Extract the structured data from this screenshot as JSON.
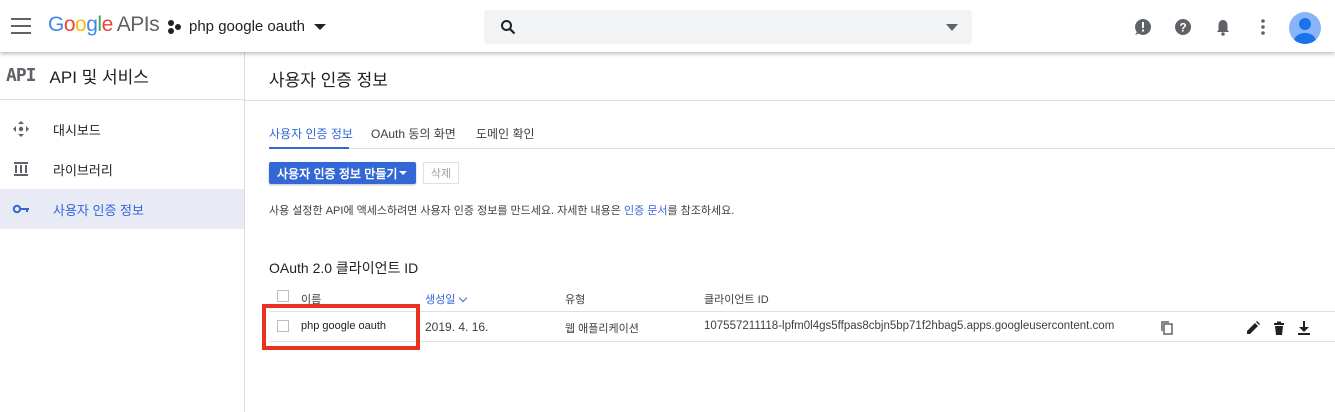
{
  "header": {
    "logo_text": "Google",
    "logo_suffix": "APIs",
    "project_name": "php google oauth",
    "search": {
      "placeholder": ""
    }
  },
  "sidebar": {
    "badge": "API",
    "title": "API 및 서비스",
    "items": [
      {
        "label": "대시보드",
        "icon": "dashboard-icon"
      },
      {
        "label": "라이브러리",
        "icon": "library-icon"
      },
      {
        "label": "사용자 인증 정보",
        "icon": "key-icon",
        "active": true
      }
    ]
  },
  "main": {
    "page_title": "사용자 인증 정보",
    "tabs": [
      {
        "label": "사용자 인증 정보",
        "active": true
      },
      {
        "label": "OAuth 동의 화면"
      },
      {
        "label": "도메인 확인"
      }
    ],
    "create_button": "사용자 인증 정보 만들기",
    "delete_button": "삭제",
    "description_before": "사용 설정한 API에 액세스하려면 사용자 인증 정보를 만드세요. 자세한 내용은 ",
    "description_link": "인증 문서",
    "description_after": "를 참조하세요.",
    "section_title": "OAuth 2.0 클라이언트 ID",
    "table": {
      "columns": [
        "이름",
        "생성일",
        "유형",
        "클라이언트 ID"
      ],
      "rows": [
        {
          "name": "php google oauth",
          "created": "2019. 4. 16.",
          "type": "웹 애플리케이션",
          "client_id": "107557211118-lpfm0l4gs5ffpas8cbjn5bp71f2hbag5.apps.googleusercontent.com"
        }
      ]
    }
  },
  "colors": {
    "accent": "#3367d6",
    "highlight": "#e8311f"
  }
}
